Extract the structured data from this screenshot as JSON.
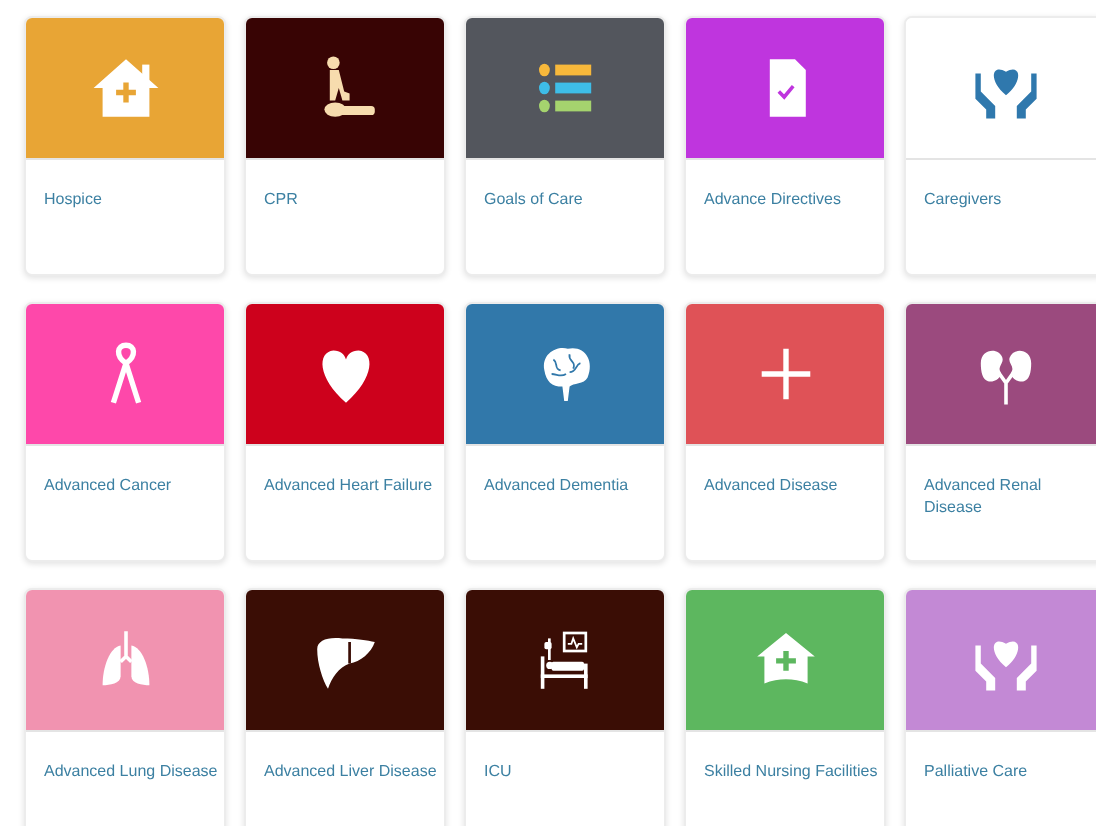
{
  "cards": [
    {
      "label": "Hospice",
      "color": "#e8a535",
      "kind": "house"
    },
    {
      "label": "CPR",
      "color": "#380404",
      "kind": "cpr"
    },
    {
      "label": "Goals of Care",
      "color": "#53565d",
      "kind": "list"
    },
    {
      "label": "Advance Directives",
      "color": "#bf35de",
      "kind": "document"
    },
    {
      "label": "Caregivers",
      "color": "#ffffff",
      "kind": "hands"
    },
    {
      "label": "Advanced Cancer",
      "color": "#fe48aa",
      "kind": "ribbon"
    },
    {
      "label": "Advanced Heart Failure",
      "color": "#cd011c",
      "kind": "heart"
    },
    {
      "label": "Advanced Dementia",
      "color": "#3178aa",
      "kind": "brain"
    },
    {
      "label": "Advanced Disease",
      "color": "#df5257",
      "kind": "plus"
    },
    {
      "label": "Advanced Renal Disease",
      "color": "#9b4a7e",
      "kind": "kidneys"
    },
    {
      "label": "Advanced Lung Disease",
      "color": "#f193b0",
      "kind": "lungs"
    },
    {
      "label": "Advanced Liver Disease",
      "color": "#3a0d05",
      "kind": "liver"
    },
    {
      "label": "ICU",
      "color": "#3a0d05",
      "kind": "bed"
    },
    {
      "label": "Skilled Nursing Facilities",
      "color": "#5db75f",
      "kind": "clinic"
    },
    {
      "label": "Palliative Care",
      "color": "#c389d5",
      "kind": "hands"
    }
  ]
}
